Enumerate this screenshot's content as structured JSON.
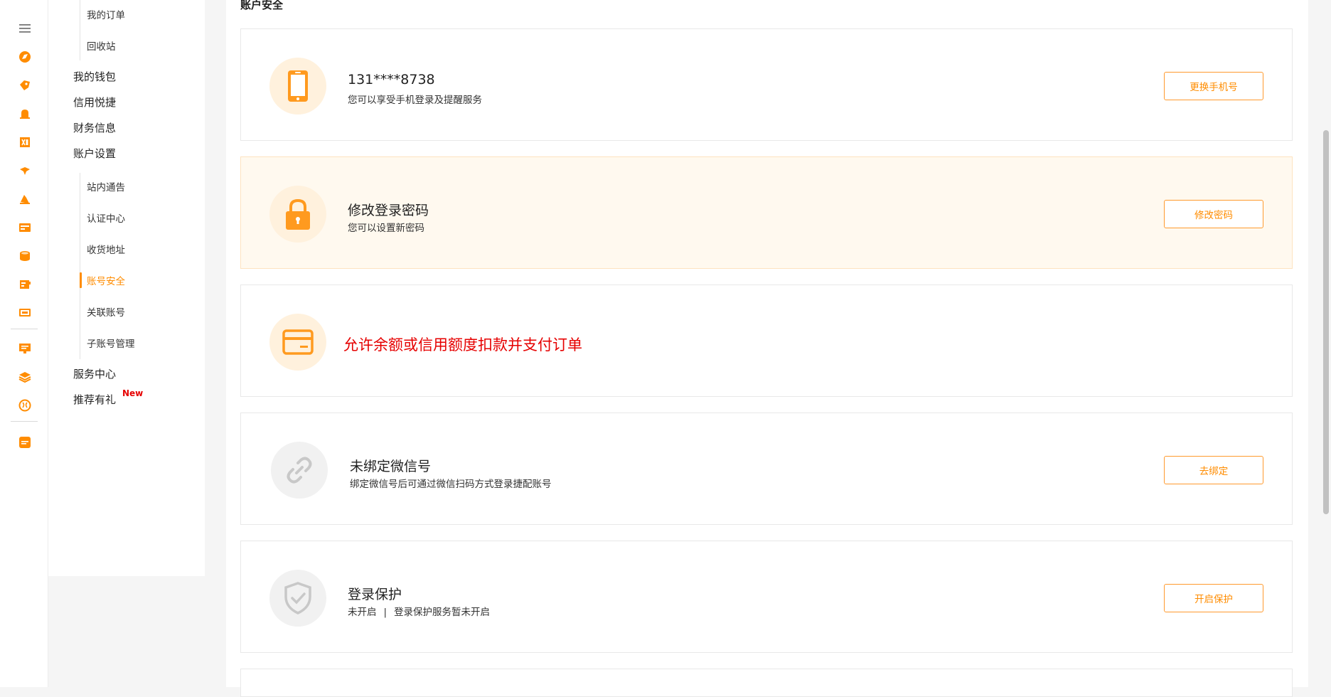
{
  "rail": {
    "icons": [
      "menu-icon",
      "discover-icon",
      "tag-icon",
      "bell-icon",
      "excel-icon",
      "bird-icon",
      "bucket-icon",
      "card-icon",
      "coin-icon",
      "box-icon",
      "monitor-icon",
      "chart-icon",
      "layers-icon",
      "brain-icon",
      "app-icon"
    ]
  },
  "menu": {
    "orders": "我的订单",
    "recycle": "回收站",
    "wallet": "我的钱包",
    "credit": "信用悦捷",
    "finance": "财务信息",
    "account_settings": "账户设置",
    "sub": {
      "notice": "站内通告",
      "auth": "认证中心",
      "address": "收货地址",
      "security": "账号安全",
      "linked": "关联账号",
      "subaccount": "子账号管理"
    },
    "service": "服务中心",
    "referral": "推荐有礼",
    "new_badge": "New"
  },
  "main": {
    "section_title": "账户安全",
    "cards": {
      "phone": {
        "title": "131****8738",
        "desc": "您可以享受手机登录及提醒服务",
        "button": "更换手机号"
      },
      "password": {
        "title": "修改登录密码",
        "desc": "您可以设置新密码",
        "button": "修改密码"
      },
      "balance": {
        "text": "允许余额或信用额度扣款并支付订单"
      },
      "wechat": {
        "title": "未绑定微信号",
        "desc": "绑定微信号后可通过微信扫码方式登录捷配账号",
        "button": "去绑定"
      },
      "protect": {
        "title": "登录保护",
        "status": "未开启",
        "separator": "|",
        "desc": "登录保护服务暂未开启",
        "button": "开启保护"
      }
    }
  },
  "colors": {
    "accent": "#ff8c00",
    "danger": "#e60000",
    "icon_bg": "#fff1dd"
  }
}
